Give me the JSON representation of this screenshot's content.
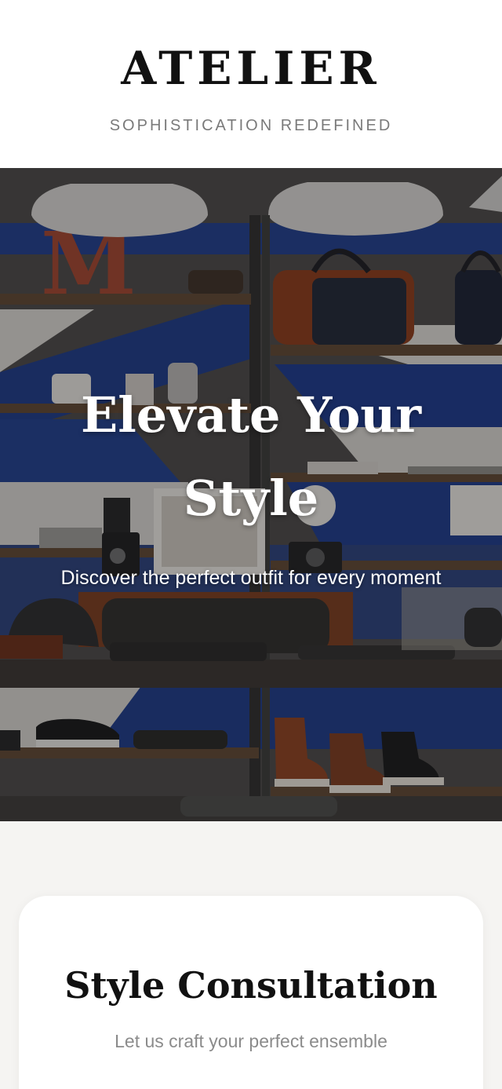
{
  "header": {
    "brand": "ATELIER",
    "tagline": "SOPHISTICATION REDEFINED"
  },
  "hero": {
    "title": "Elevate Your Style",
    "subtitle": "Discover the perfect outfit for every moment",
    "image_description_icon": "store-shelves-image"
  },
  "consultation": {
    "title": "Style Consultation",
    "subtitle": "Let us craft your perfect ensemble"
  },
  "colors": {
    "header_bg": "#ffffff",
    "page_bg": "#f5f4f2",
    "text_dark": "#111111",
    "text_muted": "#7a7a7a",
    "hero_text": "#ffffff"
  }
}
